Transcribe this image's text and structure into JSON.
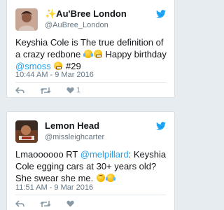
{
  "colors": {
    "accent": "#1da1f2",
    "background": "#e6ecf0",
    "muted": "#8899a6"
  },
  "tweets": [
    {
      "name": "✨Au'Bree London",
      "handle": "@AuBree_London",
      "text_part1": "Keyshia Cole is The true definition of a crazy redbone ",
      "text_part2": " Happy birthday ",
      "mention": "@smoss",
      "text_part3": " #29",
      "emojis": [
        "tears-of-joy",
        "grimace",
        "grimace"
      ],
      "timestamp": "10:44 AM - 9 Mar 2016",
      "like_count": "1"
    },
    {
      "name": "Lemon Head",
      "handle": "@missleighcarter",
      "text_part1": "Lmaoooooo RT ",
      "mention": "@melpillard",
      "text_part2": ": Keyshia Cole egging cars at 30+ years old? She swear she me. ",
      "emojis": [
        "upside-down-face",
        "tears-of-joy"
      ],
      "timestamp": "11:51 AM - 9 Mar 2016",
      "like_count": ""
    }
  ],
  "icons": {
    "reply": "reply-icon",
    "retweet": "retweet-icon",
    "like": "heart-icon",
    "brand": "twitter-bird-icon"
  }
}
